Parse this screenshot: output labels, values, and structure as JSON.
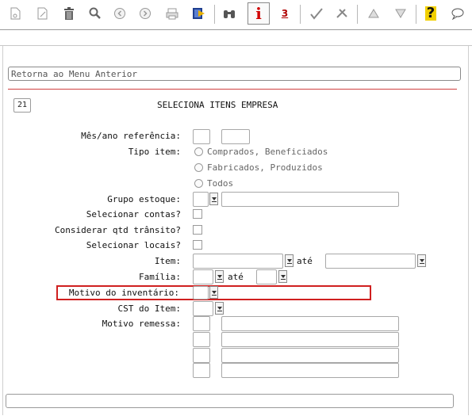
{
  "toolbar": {
    "icons": [
      "new-page-icon",
      "edit-icon",
      "trash-icon",
      "search-icon",
      "prev-icon",
      "next-icon",
      "print-icon",
      "exit-icon",
      "binoculars-icon",
      "info-icon",
      "zoom-icon",
      "check-icon",
      "tools-icon",
      "up-icon",
      "down-icon",
      "help-icon",
      "chat-icon"
    ],
    "info_glyph": "i",
    "zoom_glyph": "3",
    "help_glyph": "?"
  },
  "command_field": {
    "value": "Retorna ao Menu Anterior"
  },
  "program": {
    "number": "21",
    "title": "SELECIONA ITENS EMPRESA"
  },
  "form": {
    "mes_ano": {
      "label": "Mês/ano referência:"
    },
    "tipo_item": {
      "label": "Tipo item:",
      "options": [
        "Comprados, Beneficiados",
        "Fabricados, Produzidos",
        "Todos"
      ]
    },
    "grupo_estoque": {
      "label": "Grupo estoque:"
    },
    "selecionar_contas": {
      "label": "Selecionar contas?"
    },
    "considerar_qtd": {
      "label": "Considerar qtd trânsito?"
    },
    "selecionar_locais": {
      "label": "Selecionar locais?"
    },
    "item": {
      "label": "Item:",
      "ate": "até"
    },
    "familia": {
      "label": "Família:",
      "ate": "até"
    },
    "motivo_inventario": {
      "label": "Motivo do inventário:"
    },
    "cst_item": {
      "label": "CST do Item:"
    },
    "motivo_remessa": {
      "label": "Motivo remessa:"
    }
  },
  "colors": {
    "highlight": "#d02020",
    "separator_red": "#d04040"
  }
}
